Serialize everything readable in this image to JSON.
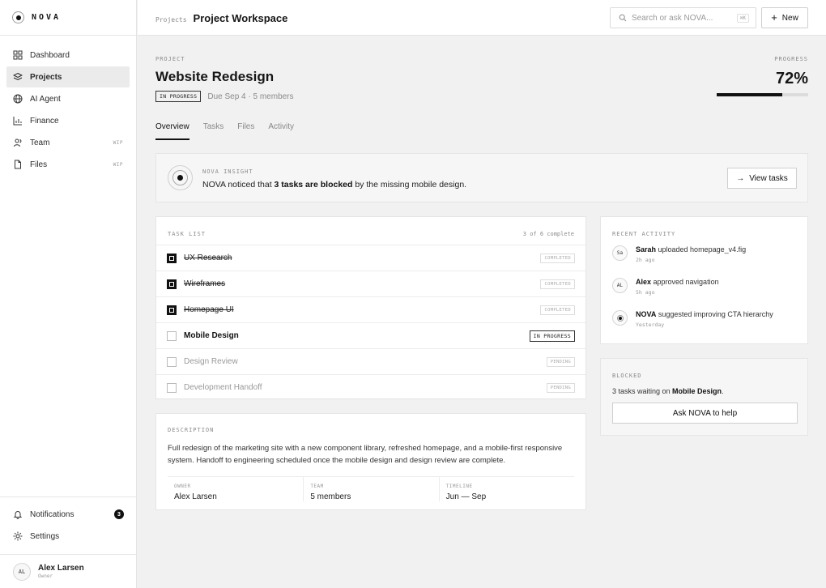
{
  "brand": {
    "name": "NOVA"
  },
  "sidebar": {
    "items": [
      {
        "label": "Dashboard",
        "tag": ""
      },
      {
        "label": "Projects",
        "tag": ""
      },
      {
        "label": "AI Agent",
        "tag": ""
      },
      {
        "label": "Finance",
        "tag": ""
      },
      {
        "label": "Team",
        "tag": "WIP"
      },
      {
        "label": "Files",
        "tag": "WIP"
      }
    ],
    "bottom": {
      "notifications": "Notifications",
      "notif_count": "3",
      "settings": "Settings"
    },
    "user": {
      "initials": "AL",
      "name": "Alex Larsen",
      "role": "Owner"
    }
  },
  "topbar": {
    "breadcrumb": "Projects",
    "title": "Project Workspace",
    "search_placeholder": "Search or ask NOVA...",
    "search_shortcut": "⌘K",
    "new_label": "New"
  },
  "project": {
    "eyebrow": "PROJECT",
    "title": "Website Redesign",
    "status": "IN PROGRESS",
    "meta": "Due Sep 4 · 5 members",
    "progress_label": "PROGRESS",
    "progress_text": "72%",
    "progress_value": 0.72
  },
  "tabs": [
    "Overview",
    "Tasks",
    "Files",
    "Activity"
  ],
  "insight": {
    "eyebrow": "NOVA INSIGHT",
    "text_before": "NOVA noticed that ",
    "text_bold": "3 tasks are blocked",
    "text_after": " by the missing mobile design.",
    "button": "View tasks"
  },
  "tasks": {
    "title": "TASK LIST",
    "count": "3 of 6 complete",
    "items": [
      {
        "name": "UX Research",
        "status": "COMPLETED"
      },
      {
        "name": "Wireframes",
        "status": "COMPLETED"
      },
      {
        "name": "Homepage UI",
        "status": "COMPLETED"
      },
      {
        "name": "Mobile Design",
        "status": "IN PROGRESS"
      },
      {
        "name": "Design Review",
        "status": "PENDING"
      },
      {
        "name": "Development Handoff",
        "status": "PENDING"
      }
    ]
  },
  "description": {
    "title": "DESCRIPTION",
    "text": "Full redesign of the marketing site with a new component library, refreshed homepage, and a mobile-first responsive system. Handoff to engineering scheduled once the mobile design and design review are complete.",
    "cols": [
      {
        "label": "OWNER",
        "value": "Alex Larsen"
      },
      {
        "label": "TEAM",
        "value": "5 members"
      },
      {
        "label": "TIMELINE",
        "value": "Jun — Sep"
      }
    ]
  },
  "activity": {
    "title": "RECENT ACTIVITY",
    "items": [
      {
        "avatar": "Sa",
        "who": "Sarah",
        "what": " uploaded homepage_v4.fig",
        "time": "2h ago"
      },
      {
        "avatar": "AL",
        "who": "Alex",
        "what": " approved navigation",
        "time": "5h ago"
      },
      {
        "avatar": "",
        "who": "NOVA",
        "what": " suggested improving CTA hierarchy",
        "time": "Yesterday"
      }
    ]
  },
  "blocked": {
    "title": "BLOCKED",
    "text_before": "3 tasks waiting on ",
    "text_bold": "Mobile Design",
    "text_after": ".",
    "button": "Ask NOVA to help"
  }
}
